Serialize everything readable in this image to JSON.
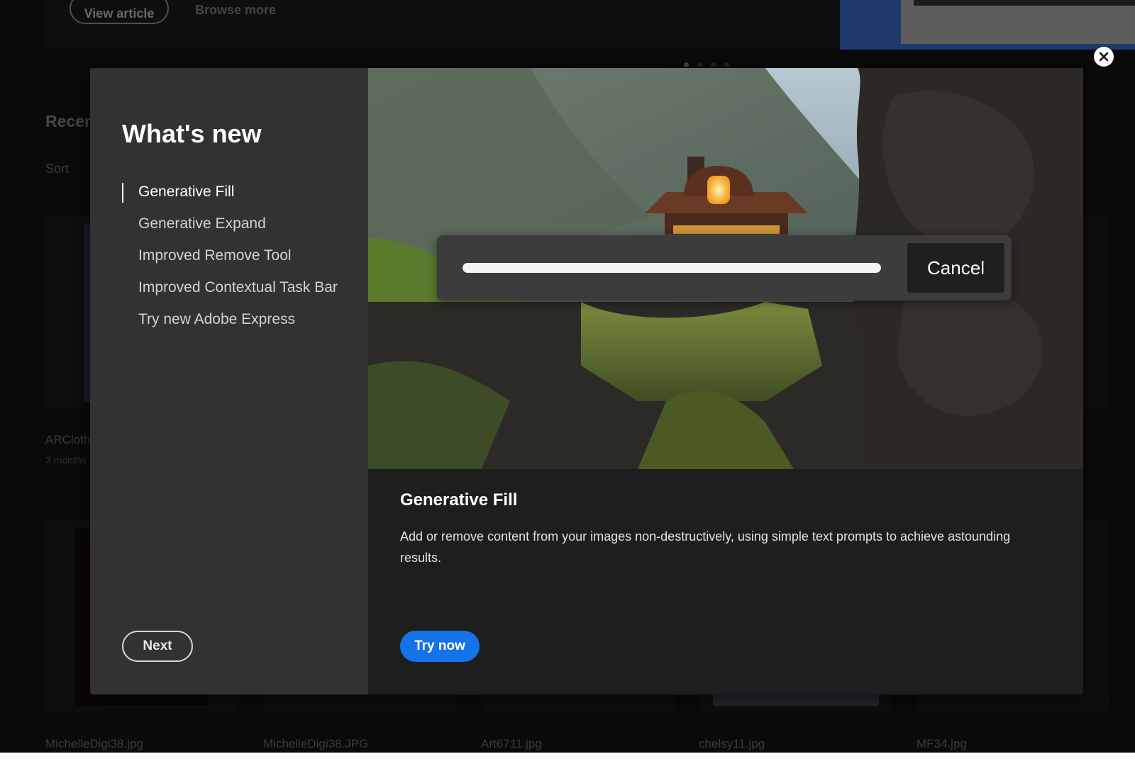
{
  "background": {
    "article": {
      "view_article_label": "View article",
      "browse_more_label": "Browse more"
    },
    "section_heading": "Recen",
    "sort_label": "Sort",
    "files": [
      {
        "name": "ARCloth",
        "meta": "3 months"
      },
      {
        "name": "MichelleDigi38.jpg"
      },
      {
        "name": "MichelleDigi38.JPG"
      },
      {
        "name": "Art6711.jpg"
      },
      {
        "name": "chelsy11.jpg"
      },
      {
        "name": "MF34.jpg"
      }
    ]
  },
  "modal": {
    "title": "What's new",
    "features": [
      {
        "label": "Generative Fill",
        "active": true
      },
      {
        "label": "Generative Expand",
        "active": false
      },
      {
        "label": "Improved Remove Tool",
        "active": false
      },
      {
        "label": "Improved Contextual Task Bar",
        "active": false
      },
      {
        "label": "Try new Adobe Express",
        "active": false
      }
    ],
    "next_label": "Next",
    "hero": {
      "progress_fraction": 1.0,
      "cancel_label": "Cancel"
    },
    "detail": {
      "title": "Generative Fill",
      "description": "Add or remove content from your images non-destructively, using simple text prompts to achieve astounding results."
    },
    "try_now_label": "Try now",
    "close_icon": "close-icon"
  },
  "colors": {
    "accent": "#1473e6",
    "sidebar": "#323232",
    "panel": "#1e1e1e"
  }
}
